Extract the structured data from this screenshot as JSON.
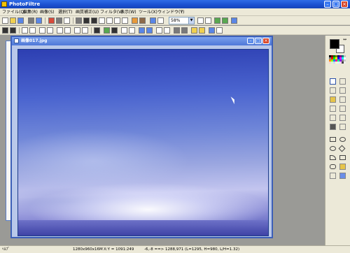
{
  "app": {
    "title": "PhotoFiltre"
  },
  "menu": {
    "items": [
      "ファイル(Q)",
      "編集(R)",
      "画像(S)",
      "選択(T)",
      "画質補正(U)",
      "フィルタ(V)",
      "表示(W)",
      "ツール(X)",
      "ウィンドウ(Y)",
      "?"
    ]
  },
  "toolbar": {
    "zoom_value": "58%"
  },
  "document": {
    "title": "画像017.jpg"
  },
  "status": {
    "left": "ﾍﾙﾌﾟ",
    "dimensions": "1280x960x16M",
    "xy": "X:Y = 1091:249",
    "selection": "-6,-8 ==> 1288,971 (L=1295, H=980, L/H=1.32)"
  },
  "colors": {
    "titlebar": "#1a4fd0",
    "workspace": "#9a9a96",
    "panel": "#ece9d8",
    "sky_top": "#2d3fb2",
    "sky_light": "#c3c5ef"
  }
}
